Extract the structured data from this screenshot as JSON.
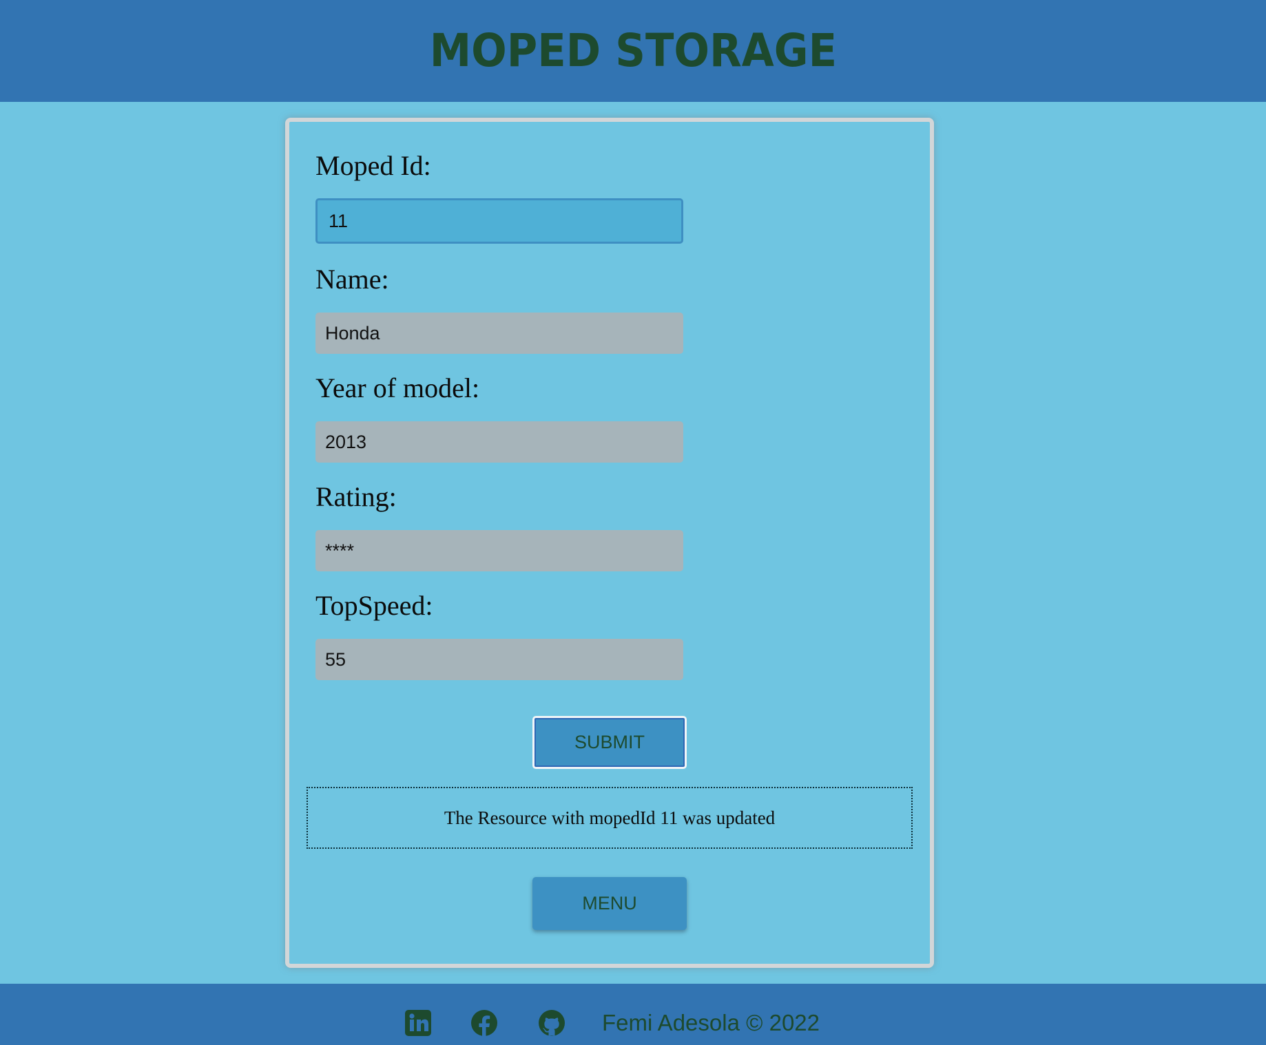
{
  "header": {
    "title": "MOPED STORAGE"
  },
  "form": {
    "fields": [
      {
        "label": "Moped Id:",
        "value": "11",
        "focused": true
      },
      {
        "label": "Name:",
        "value": "Honda"
      },
      {
        "label": "Year of model:",
        "value": "2013"
      },
      {
        "label": "Rating:",
        "value": "****"
      },
      {
        "label": "TopSpeed:",
        "value": "55"
      }
    ],
    "submit_label": "SUBMIT",
    "message": "The Resource with mopedId 11 was updated",
    "menu_label": "MENU"
  },
  "footer": {
    "icons": [
      "linkedin-icon",
      "facebook-icon",
      "github-icon"
    ],
    "copyright": "Femi Adesola © 2022"
  },
  "colors": {
    "header_bg": "#3274b2",
    "page_bg": "#6fc5e1",
    "title_color": "#1d4a2e",
    "input_bg": "#a6b4ba",
    "input_focused_bg": "#4fb0d6",
    "button_bg": "#3d91c3"
  }
}
